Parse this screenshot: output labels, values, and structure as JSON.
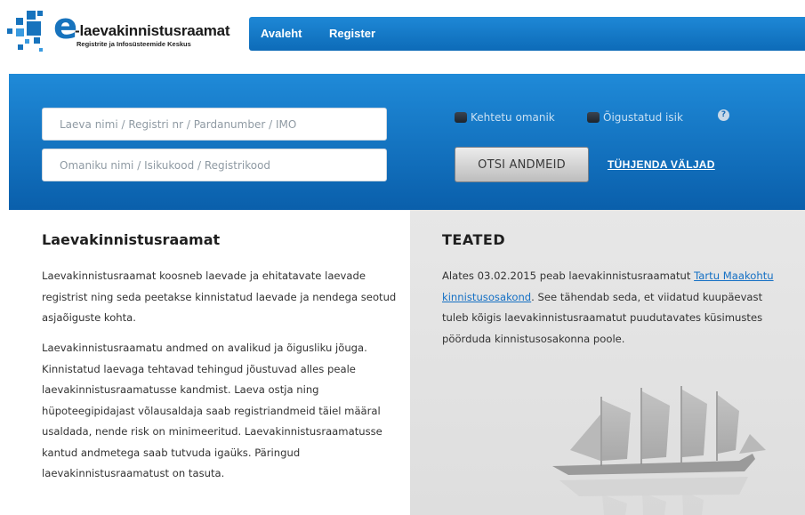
{
  "header": {
    "logo_e": "e",
    "logo_title": "-laevakinnistusraamat",
    "logo_subtitle": "Registrite ja Infosüsteemide Keskus",
    "nav": {
      "home": "Avaleht",
      "register": "Register"
    },
    "brand_color": "#1773bd"
  },
  "search": {
    "ship_placeholder": "Laeva nimi / Registri nr / Pardanumber / IMO",
    "owner_placeholder": "Omaniku nimi / Isikukood / Registrikood",
    "checkbox_invalid_owner": "Kehtetu omanik",
    "checkbox_authorized_person": "Õigustatud isik",
    "help": "?",
    "search_button": "OTSI ANDMEID",
    "clear_link": "TÜHJENDA VÄLJAD",
    "band_color": "#1a80cf"
  },
  "main": {
    "title": "Laevakinnistusraamat",
    "paragraph1": "Laevakinnistusraamat koosneb laevade ja ehitatavate laevade registrist ning seda peetakse kinnistatud laevade ja nendega seotud asjaõiguste kohta.",
    "paragraph2": "Laevakinnistusraamatu andmed on avalikud ja õigusliku jõuga. Kinnistatud laevaga tehtavad tehingud jõustuvad alles peale laevakinnistusraamatusse kandmist. Laeva ostja ning hüpoteegipidajast võlausaldaja saab registriandmeid täiel määral usaldada, nende risk on minimeeritud. Laevakinnistusraamatusse kantud andmetega saab tutvuda igaüks. Päringud laevakinnistusraamatust on tasuta."
  },
  "news": {
    "title": "TEATED",
    "text_before": "Alates 03.02.2015 peab laevakinnistusraamatut ",
    "link_text": "Tartu Maakohtu kinnistusosakond",
    "text_after": ". See tähendab seda, et viidatud kuupäevast tuleb kõigis laevakinnistusraamatut puudutavates küsimustes pöörduda kinnistusosakonna poole."
  }
}
